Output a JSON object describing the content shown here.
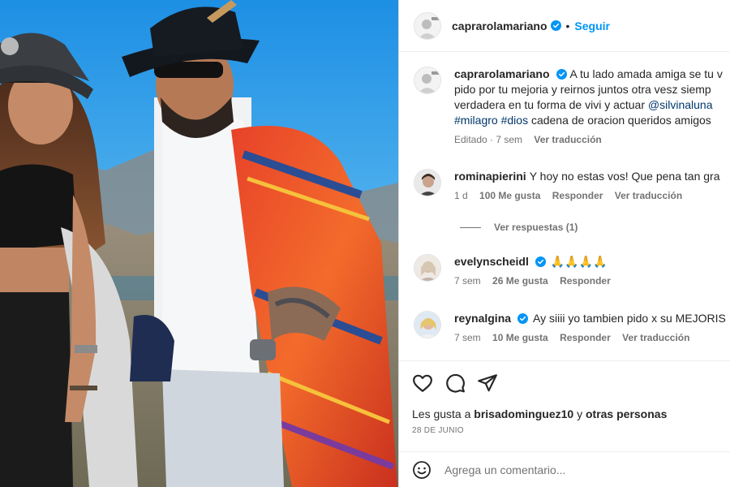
{
  "post": {
    "username": "caprarolamariano",
    "follow_label": "Seguir",
    "separator": "•"
  },
  "caption": {
    "username": "caprarolamariano",
    "line1": "A tu lado amada amiga se tu v",
    "line2": "pido por tu mejoria y reirnos juntos otra vesz siemp",
    "line3_text": "verdadera en tu forma de vivi y actuar ",
    "line3_mention": "@silvinaluna",
    "line4_tag1": "#milagro",
    "line4_tag2": "#dios",
    "line4_text": " cadena de oracion queridos amigos",
    "edited": "Editado · 7 sem",
    "translate": "Ver traducción"
  },
  "comments": [
    {
      "username": "rominapierini",
      "text": "Y hoy no estas vos! Que pena tan gra",
      "time": "1 d",
      "likes": "100 Me gusta",
      "reply": "Responder",
      "translate": "Ver traducción"
    },
    {
      "username": "evelynscheidl",
      "text": "🙏🙏🙏🙏",
      "time": "7 sem",
      "likes": "26 Me gusta",
      "reply": "Responder"
    },
    {
      "username": "reynalgina",
      "text": "Ay siiii yo tambien pido x su MEJORIS",
      "time": "7 sem",
      "likes": "10 Me gusta",
      "reply": "Responder",
      "translate": "Ver traducción"
    }
  ],
  "view_replies": "Ver respuestas (1)",
  "actions": {
    "like_icon": "heart-icon",
    "comment_icon": "comment-icon",
    "share_icon": "send-icon"
  },
  "likes": {
    "prefix": "Les gusta a ",
    "user": "brisadominguez10",
    "middle": " y ",
    "others": "otras personas"
  },
  "date": "28 DE JUNIO",
  "add_comment": {
    "placeholder": "Agrega un comentario...",
    "emoji_icon": "smiley-icon"
  },
  "colors": {
    "accent": "#0095f6",
    "link": "#00376b",
    "muted": "#737373",
    "verified": "#0095f6"
  }
}
